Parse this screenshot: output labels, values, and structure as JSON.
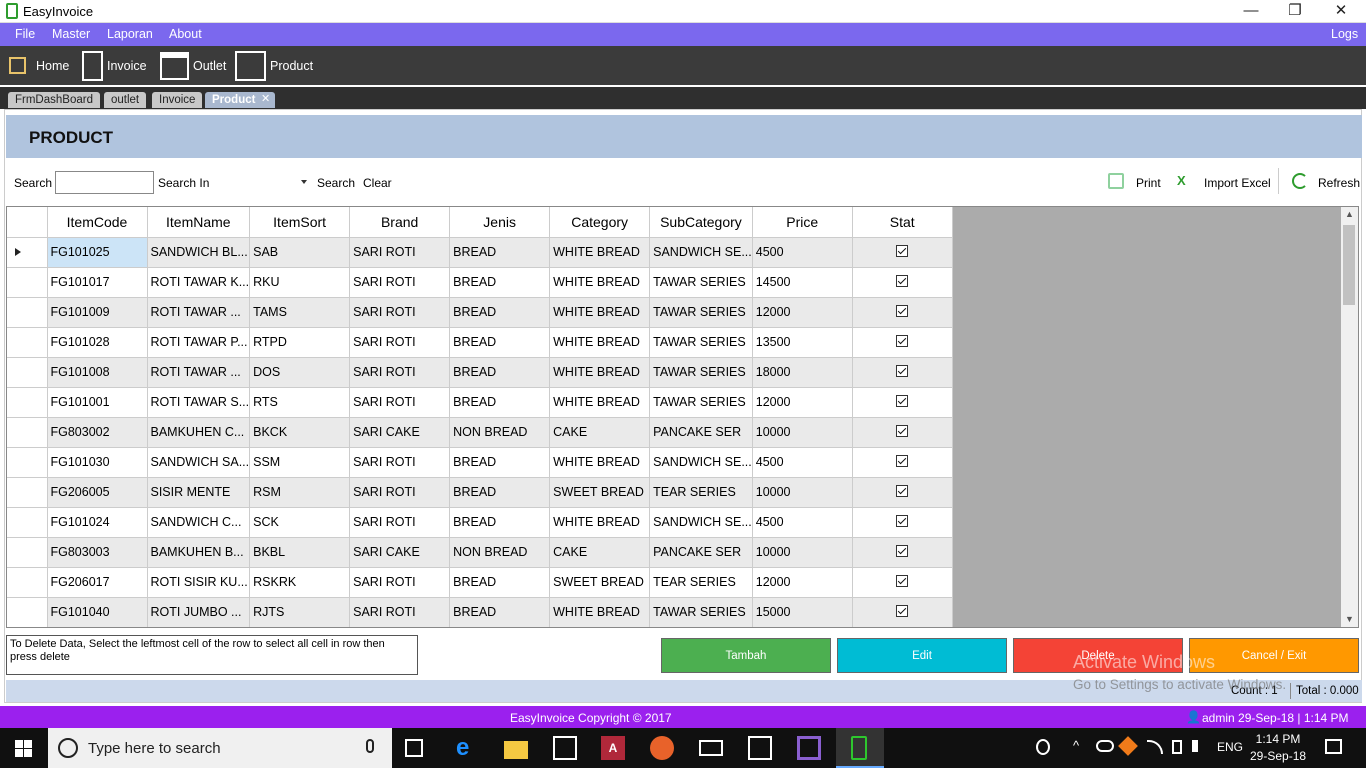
{
  "window": {
    "title": "EasyInvoice",
    "min": "—",
    "max": "❐",
    "close": "✕"
  },
  "menu": {
    "file": "File",
    "master": "Master",
    "laporan": "Laporan",
    "about": "About",
    "logs": "Logs"
  },
  "toolbar": {
    "home": "Home",
    "invoice": "Invoice",
    "outlet": "Outlet",
    "product": "Product"
  },
  "tabs": [
    {
      "label": "FrmDashBoard"
    },
    {
      "label": "outlet"
    },
    {
      "label": "Invoice"
    },
    {
      "label": "Product",
      "close": "✕"
    }
  ],
  "page": {
    "title": "PRODUCT"
  },
  "search": {
    "label": "Search",
    "value": "",
    "search_in_label": "Search In",
    "search_in_value": "",
    "search_button": "Search",
    "clear_button": "Clear",
    "print": "Print",
    "import_excel": "Import Excel",
    "refresh": "Refresh"
  },
  "table": {
    "columns": [
      "ItemCode",
      "ItemName",
      "ItemSort",
      "Brand",
      "Jenis",
      "Category",
      "SubCategory",
      "Price",
      "Stat"
    ],
    "rows": [
      [
        "FG101025",
        "SANDWICH BL...",
        "SAB",
        "SARI ROTI",
        "BREAD",
        "WHITE BREAD",
        "SANDWICH SE...",
        "4500"
      ],
      [
        "FG101017",
        "ROTI TAWAR K...",
        "RKU",
        "SARI ROTI",
        "BREAD",
        "WHITE BREAD",
        "TAWAR SERIES",
        "14500"
      ],
      [
        "FG101009",
        "ROTI TAWAR ...",
        "TAMS",
        "SARI ROTI",
        "BREAD",
        "WHITE BREAD",
        "TAWAR SERIES",
        "12000"
      ],
      [
        "FG101028",
        "ROTI TAWAR P...",
        "RTPD",
        "SARI ROTI",
        "BREAD",
        "WHITE BREAD",
        "TAWAR SERIES",
        "13500"
      ],
      [
        "FG101008",
        "ROTI TAWAR ...",
        "DOS",
        "SARI ROTI",
        "BREAD",
        "WHITE BREAD",
        "TAWAR SERIES",
        "18000"
      ],
      [
        "FG101001",
        "ROTI TAWAR S...",
        "RTS",
        "SARI ROTI",
        "BREAD",
        "WHITE BREAD",
        "TAWAR SERIES",
        "12000"
      ],
      [
        "FG803002",
        "BAMKUHEN C...",
        "BKCK",
        "SARI CAKE",
        "NON BREAD",
        "CAKE",
        "PANCAKE SER",
        "10000"
      ],
      [
        "FG101030",
        "SANDWICH SA...",
        "SSM",
        "SARI ROTI",
        "BREAD",
        "WHITE BREAD",
        "SANDWICH SE...",
        "4500"
      ],
      [
        "FG206005",
        "SISIR MENTE",
        "RSM",
        "SARI ROTI",
        "BREAD",
        "SWEET BREAD",
        "TEAR SERIES",
        "10000"
      ],
      [
        "FG101024",
        "SANDWICH C...",
        "SCK",
        "SARI ROTI",
        "BREAD",
        "WHITE BREAD",
        "SANDWICH SE...",
        "4500"
      ],
      [
        "FG803003",
        "BAMKUHEN B...",
        "BKBL",
        "SARI CAKE",
        "NON BREAD",
        "CAKE",
        "PANCAKE SER",
        "10000"
      ],
      [
        "FG206017",
        "ROTI SISIR KU...",
        "RSKRK",
        "SARI ROTI",
        "BREAD",
        "SWEET BREAD",
        "TEAR SERIES",
        "12000"
      ],
      [
        "FG101040",
        "ROTI JUMBO ...",
        "RJTS",
        "SARI ROTI",
        "BREAD",
        "WHITE BREAD",
        "TAWAR SERIES",
        "15000"
      ]
    ]
  },
  "note": "To Delete Data, Select the leftmost cell of the row to select all cell in row then press delete",
  "actions": {
    "tambah": "Tambah",
    "edit": "Edit",
    "delete": "Delete",
    "cancel": "Cancel / Exit"
  },
  "status": {
    "count": "Count : 1",
    "total": "Total : 0.000"
  },
  "footer": {
    "copyright": "EasyInvoice Copyright ©  2017",
    "user": "admin  29-Sep-18 | 1:14 PM"
  },
  "watermark": {
    "line1": "Activate Windows",
    "line2": "Go to Settings to activate Windows."
  },
  "taskbar": {
    "search_placeholder": "Type here to search",
    "lang": "ENG",
    "time": "1:14 PM",
    "date": "29-Sep-18"
  },
  "colors": {
    "menu": "#7b68ee",
    "footer": "#9b20ee",
    "tambah": "#4caf50",
    "edit": "#00bcd4",
    "delete": "#f44336",
    "cancel": "#ff9800"
  }
}
